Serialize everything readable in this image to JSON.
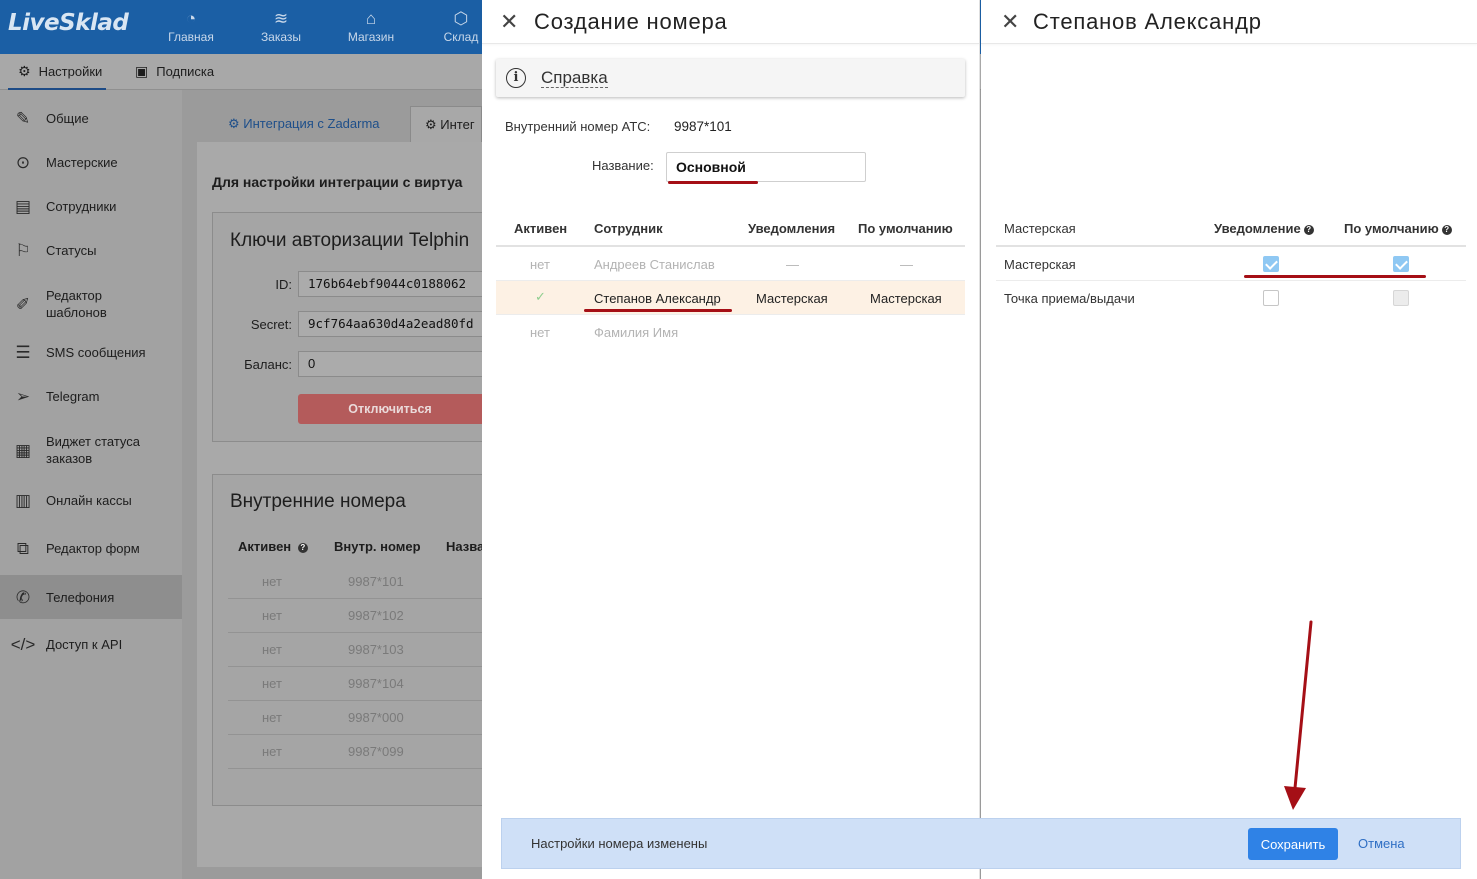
{
  "app": {
    "logo": "LiveSklad",
    "nav": [
      {
        "label": "Главная",
        "icon": "chart-pie-icon"
      },
      {
        "label": "Заказы",
        "icon": "stack-icon"
      },
      {
        "label": "Магазин",
        "icon": "basket-icon"
      },
      {
        "label": "Склад",
        "icon": "box-icon"
      }
    ],
    "subtabs": [
      {
        "label": "Настройки",
        "icon": "gear-icon"
      },
      {
        "label": "Подписка",
        "icon": "money-icon"
      }
    ],
    "sidebar": [
      {
        "label": "Общие",
        "icon": "edit-icon"
      },
      {
        "label": "Мастерские",
        "icon": "location-icon"
      },
      {
        "label": "Сотрудники",
        "icon": "id-card-icon"
      },
      {
        "label": "Статусы",
        "icon": "flag-icon"
      },
      {
        "label": "Редактор шаблонов",
        "icon": "pen-icon"
      },
      {
        "label": "SMS сообщения",
        "icon": "chat-icon"
      },
      {
        "label": "Telegram",
        "icon": "send-icon"
      },
      {
        "label": "Виджет статуса заказов",
        "icon": "widget-icon"
      },
      {
        "label": "Онлайн кассы",
        "icon": "cashbox-icon"
      },
      {
        "label": "Редактор форм",
        "icon": "form-icon"
      },
      {
        "label": "Телефония",
        "icon": "phone-icon"
      },
      {
        "label": "Доступ к API",
        "icon": "code-icon"
      }
    ],
    "content_tabs": [
      "Интеграция с Zadarma",
      "Интег"
    ],
    "intro": "Для настройки интеграции с виртуа",
    "auth_card": {
      "title": "Ключи авторизации Telphin",
      "id_label": "ID:",
      "id_value": "176b64ebf9044c0188062",
      "secret_label": "Secret:",
      "secret_value": "9cf764aa630d4a2ead80fd",
      "balance_label": "Баланс:",
      "balance_value": "0",
      "disconnect_label": "Отключиться"
    },
    "internal_card": {
      "title": "Внутренние номера",
      "headers": [
        "Активен",
        "Внутр. номер",
        "Назва"
      ],
      "rows": [
        {
          "active": "нет",
          "number": "9987*101"
        },
        {
          "active": "нет",
          "number": "9987*102"
        },
        {
          "active": "нет",
          "number": "9987*103"
        },
        {
          "active": "нет",
          "number": "9987*104"
        },
        {
          "active": "нет",
          "number": "9987*000"
        },
        {
          "active": "нет",
          "number": "9987*099"
        }
      ]
    }
  },
  "create_drawer": {
    "title": "Создание номера",
    "help": "Справка",
    "atc_label": "Внутренний номер АТС:",
    "atc_value": "9987*101",
    "name_label": "Название:",
    "name_value": "Основной",
    "headers": {
      "active": "Активен",
      "employee": "Сотрудник",
      "notifications": "Уведомления",
      "default": "По умолчанию"
    },
    "rows": [
      {
        "active": "нет",
        "employee": "Андреев Станислав",
        "notifications": "—",
        "default": "—",
        "selected": false
      },
      {
        "active": "✓",
        "employee": "Степанов Александр",
        "notifications": "Мастерская",
        "default": "Мастерская",
        "selected": true
      },
      {
        "active": "нет",
        "employee": "Фамилия Имя",
        "notifications": "",
        "default": "",
        "selected": false
      }
    ]
  },
  "employee_drawer": {
    "title": "Степанов Александр",
    "headers": {
      "workshop": "Мастерская",
      "notification": "Уведомление",
      "default": "По умолчанию"
    },
    "rows": [
      {
        "name": "Мастерская",
        "notification": true,
        "default": true
      },
      {
        "name": "Точка приема/выдачи",
        "notification": false,
        "default": false
      }
    ]
  },
  "footer": {
    "message": "Настройки номера изменены",
    "save_label": "Сохранить",
    "cancel_label": "Отмена"
  },
  "colors": {
    "accent": "#2f82e6",
    "annotation_red": "#a50f16",
    "selected_row": "#fdf1e4",
    "footer_bg": "#cfe0f7"
  }
}
